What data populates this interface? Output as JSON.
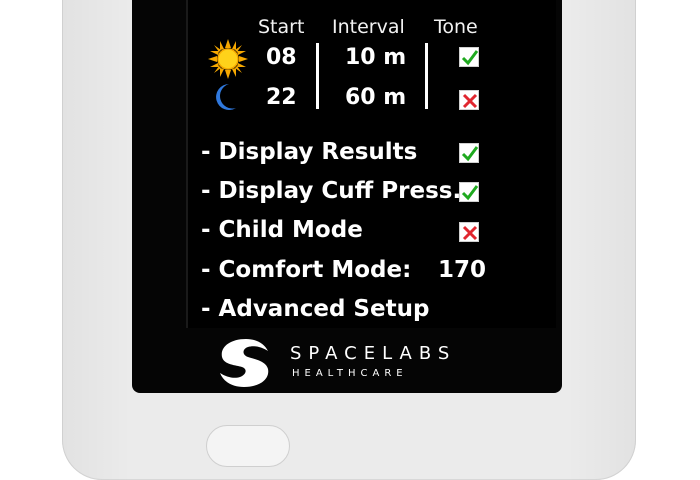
{
  "header": {
    "start": "Start",
    "interval": "Interval",
    "tone": "Tone"
  },
  "day": {
    "icon": "sun-icon",
    "start": "08",
    "interval": "10 m",
    "tone": "check"
  },
  "night": {
    "icon": "moon-icon",
    "start": "22",
    "interval": "60 m",
    "tone": "cross"
  },
  "menu": [
    {
      "label": "- Display Results",
      "state": "check"
    },
    {
      "label": "- Display Cuff Press.",
      "state": "check"
    },
    {
      "label": "- Child Mode",
      "state": "cross"
    },
    {
      "label": "- Comfort Mode:",
      "value": "170"
    },
    {
      "label": "- Advanced Setup"
    }
  ],
  "brand": {
    "name": "SPACELABS",
    "sub": "HEALTHCARE"
  },
  "colors": {
    "check": "#1fa91f",
    "cross": "#e0262f",
    "sun": "#f6b400",
    "moon": "#3a7fe0"
  }
}
